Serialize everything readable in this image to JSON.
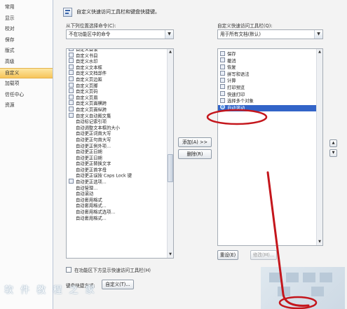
{
  "nav": {
    "items": [
      "常用",
      "显示",
      "校对",
      "保存",
      "版式",
      "高级",
      "自定义",
      "加载项",
      "信任中心",
      "资源"
    ],
    "selected_index": 6
  },
  "header": {
    "title": "自定义快速访问工具栏和键盘快捷键。"
  },
  "left_panel": {
    "choose_label": "从下列位置选择命令(C):",
    "choose_value": "不在功能区中的命令",
    "commands": [
      {
        "label": "自定义目录",
        "icon": "doc-icon",
        "submenu": true
      },
      {
        "label": "自定义书目",
        "icon": "doc-icon",
        "submenu": true
      },
      {
        "label": "自定义水印",
        "icon": "doc-icon",
        "submenu": true
      },
      {
        "label": "自定义文本框",
        "icon": "doc-icon",
        "submenu": true
      },
      {
        "label": "自定义文档部件",
        "icon": "doc-icon",
        "submenu": true
      },
      {
        "label": "自定义页边距",
        "icon": "doc-icon",
        "submenu": true
      },
      {
        "label": "自定义页脚",
        "icon": "doc-icon",
        "submenu": true
      },
      {
        "label": "自定义页码",
        "icon": "doc-icon",
        "submenu": true
      },
      {
        "label": "自定义页眉",
        "icon": "doc-icon",
        "submenu": true
      },
      {
        "label": "自定义页面横跨",
        "icon": "doc-icon",
        "submenu": true
      },
      {
        "label": "自定义页面纵跨",
        "icon": "doc-icon",
        "submenu": true
      },
      {
        "label": "自定义自动图文集",
        "icon": "doc-icon",
        "submenu": true
      },
      {
        "label": "自动标记索引项",
        "icon": "",
        "submenu": false
      },
      {
        "label": "自动调整文本框的大小",
        "icon": "",
        "submenu": false
      },
      {
        "label": "自动更正词首大写",
        "icon": "",
        "submenu": false
      },
      {
        "label": "自动更正句首大写",
        "icon": "",
        "submenu": false
      },
      {
        "label": "自动更正例外项...",
        "icon": "",
        "submenu": false
      },
      {
        "label": "自动更正日期",
        "icon": "",
        "submenu": false
      },
      {
        "label": "自动更正日期",
        "icon": "",
        "submenu": false
      },
      {
        "label": "自动更正替换文字",
        "icon": "",
        "submenu": false
      },
      {
        "label": "自动更正首字母",
        "icon": "",
        "submenu": false
      },
      {
        "label": "自动更正误按 Caps Lock 键",
        "icon": "",
        "submenu": false
      },
      {
        "label": "自动更正选项...",
        "icon": "pen-icon",
        "submenu": false
      },
      {
        "label": "自动管理...",
        "icon": "",
        "submenu": false
      },
      {
        "label": "自动滚动",
        "icon": "",
        "submenu": false
      },
      {
        "label": "自动套用格式",
        "icon": "",
        "submenu": false
      },
      {
        "label": "自动套用格式...",
        "icon": "",
        "submenu": false
      },
      {
        "label": "自动套用格式选项...",
        "icon": "",
        "submenu": false
      },
      {
        "label": "自动套用格式...",
        "icon": "",
        "submenu": false
      }
    ],
    "show_below_label": "在功能区下方显示快速访问工具栏(H)",
    "keyboard_label": "键盘快捷方式:",
    "customize_button": "自定义(T)..."
  },
  "middle": {
    "add_button": "添加(A) >>",
    "remove_button": "删除(R)"
  },
  "right_panel": {
    "customize_label": "自定义快速访问工具栏(Q):",
    "for_value": "用于所有文档(默认)",
    "commands": [
      {
        "label": "保存",
        "icon": "save-icon",
        "submenu": false
      },
      {
        "label": "撤消",
        "icon": "undo-icon",
        "submenu": true
      },
      {
        "label": "恢复",
        "icon": "redo-icon",
        "submenu": false
      },
      {
        "label": "拼写和语法",
        "icon": "spellcheck-icon",
        "submenu": false
      },
      {
        "label": "计算",
        "icon": "calculate-icon",
        "submenu": false
      },
      {
        "label": "打印预览",
        "icon": "print-preview-icon",
        "submenu": false
      },
      {
        "label": "快速打印",
        "icon": "print-icon",
        "submenu": false
      },
      {
        "label": "选择多个对象",
        "icon": "select-objects-icon",
        "submenu": false
      },
      {
        "label": "自动滚动",
        "icon": "autoscroll-icon",
        "submenu": false
      }
    ],
    "selected_index": 8,
    "reset_button": "重设(E)",
    "modify_button": "修改(M)..."
  },
  "watermark": "软 件 教 程 之 家"
}
